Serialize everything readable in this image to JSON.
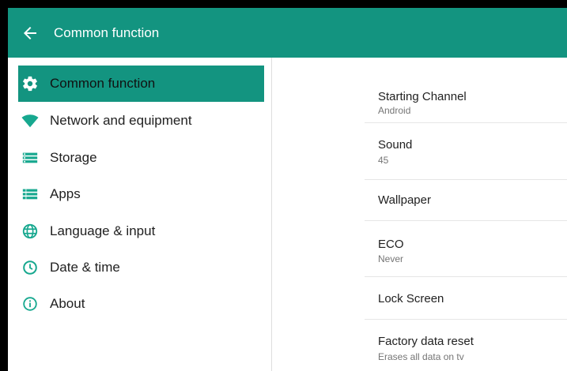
{
  "appbar": {
    "title": "Common function",
    "back_icon": "arrow-left-icon"
  },
  "colors": {
    "primary": "#139480",
    "accent_icon": "#17a88f"
  },
  "sidebar": {
    "items": [
      {
        "label": "Common function",
        "icon": "gear-icon",
        "active": true
      },
      {
        "label": "Network and equipment",
        "icon": "wifi-icon",
        "active": false
      },
      {
        "label": "Storage",
        "icon": "storage-icon",
        "active": false
      },
      {
        "label": "Apps",
        "icon": "apps-list-icon",
        "active": false
      },
      {
        "label": "Language & input",
        "icon": "globe-icon",
        "active": false
      },
      {
        "label": "Date & time",
        "icon": "clock-icon",
        "active": false
      },
      {
        "label": "About",
        "icon": "info-icon",
        "active": false
      }
    ]
  },
  "settings": {
    "rows": [
      {
        "title": "Starting Channel",
        "subtitle": "Android"
      },
      {
        "title": "Sound",
        "subtitle": "45"
      },
      {
        "title": "Wallpaper",
        "subtitle": ""
      },
      {
        "title": "ECO",
        "subtitle": "Never"
      },
      {
        "title": "Lock Screen",
        "subtitle": ""
      },
      {
        "title": "Factory data reset",
        "subtitle": "Erases all data on tv"
      }
    ]
  }
}
